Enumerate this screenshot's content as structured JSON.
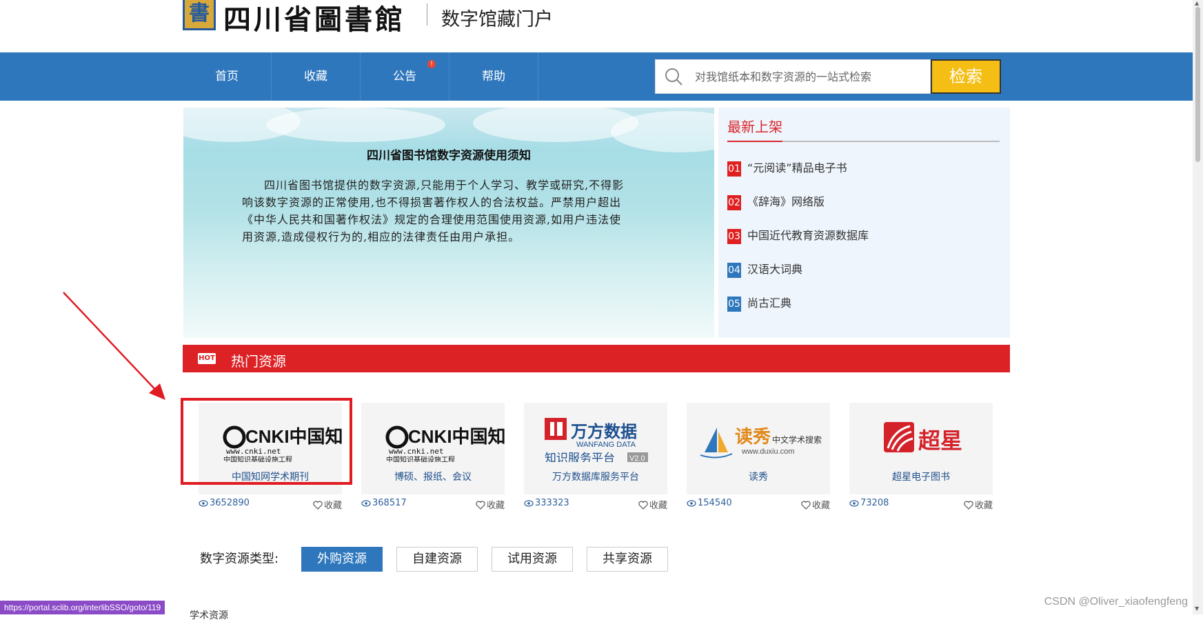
{
  "header": {
    "logo_seal_char": "書",
    "library_name": "四川省圖書館",
    "portal_title": "数字馆藏门户"
  },
  "nav": {
    "items": [
      {
        "label": "首页"
      },
      {
        "label": "收藏"
      },
      {
        "label": "公告",
        "badge": "!"
      },
      {
        "label": "帮助"
      }
    ],
    "search_placeholder": "对我馆纸本和数字资源的一站式检索",
    "search_button": "检索"
  },
  "notice": {
    "title": "四川省图书馆数字资源使用须知",
    "body": "四川省图书馆提供的数字资源,只能用于个人学习、教学或研究,不得影响该数字资源的正常使用,也不得损害著作权人的合法权益。严禁用户超出《中华人民共和国著作权法》规定的合理使用范围使用资源,如用户违法使用资源,造成侵权行为的,相应的法律责任由用户承担。"
  },
  "newest": {
    "title": "最新上架",
    "items": [
      {
        "num": "01",
        "text": "“元阅读”精品电子书",
        "color": "#e02020"
      },
      {
        "num": "02",
        "text": "《辞海》网络版",
        "color": "#e02020"
      },
      {
        "num": "03",
        "text": "中国近代教育资源数据库",
        "color": "#e02020"
      },
      {
        "num": "04",
        "text": "汉语大词典",
        "color": "#2f77bd"
      },
      {
        "num": "05",
        "text": "尚古汇典",
        "color": "#2f77bd"
      }
    ]
  },
  "hot": {
    "tag": "HOT",
    "title": "热门资源",
    "fav_label": "收藏",
    "cards": [
      {
        "logo": "cnki",
        "logo_main": "CNKI中国知网",
        "logo_url": "www.cnki.net",
        "logo_sub": "中国知识基础设施工程",
        "label": "中国知网学术期刊",
        "views": "3652890"
      },
      {
        "logo": "cnki",
        "logo_main": "CNKI中国知网",
        "logo_url": "www.cnki.net",
        "logo_sub": "中国知识基础设施工程",
        "label": "博硕、报纸、会议",
        "views": "368517"
      },
      {
        "logo": "wanfang",
        "logo_main": "万方数据",
        "logo_url": "WANFANG DATA",
        "logo_sub": "知识服务平台",
        "logo_ver": "V2.0",
        "label": "万方数据库服务平台",
        "views": "333323"
      },
      {
        "logo": "duxiu",
        "logo_main": "读秀",
        "logo_url": "www.duxiu.com",
        "logo_sub": "中文学术搜索",
        "label": "读秀",
        "views": "154540"
      },
      {
        "logo": "chaoxing",
        "logo_main": "超星",
        "label": "超星电子图书",
        "views": "73208"
      }
    ]
  },
  "types": {
    "label": "数字资源类型:",
    "buttons": [
      "外购资源",
      "自建资源",
      "试用资源",
      "共享资源"
    ],
    "active_index": 0,
    "partial_heading": "学术资源"
  },
  "chrome": {
    "status_url": "https://portal.sclib.org/interlibSSO/goto/119",
    "watermark": "CSDN @Oliver_xiaofengfeng"
  },
  "colors": {
    "nav_blue": "#2f77bd",
    "hot_red": "#dd2226",
    "search_yellow": "#f5be14"
  }
}
